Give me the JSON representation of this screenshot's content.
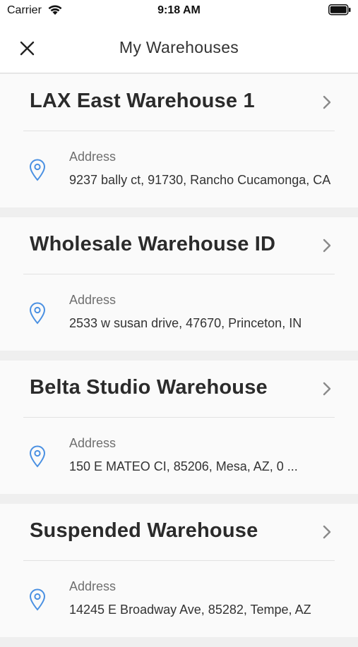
{
  "status_bar": {
    "carrier": "Carrier",
    "time": "9:18 AM",
    "wifi_icon": "wifi-icon",
    "battery_icon": "battery-icon"
  },
  "nav": {
    "title": "My Warehouses",
    "close_icon": "close-icon"
  },
  "colors": {
    "pin": "#4a90e2",
    "background": "#efefef",
    "card": "#fafafa"
  },
  "warehouses": [
    {
      "name": "LAX East Warehouse 1",
      "address_label": "Address",
      "address": "9237 bally ct, 91730, Rancho Cucamonga, CA"
    },
    {
      "name": "Wholesale Warehouse ID",
      "address_label": "Address",
      "address": "2533 w susan drive, 47670, Princeton, IN"
    },
    {
      "name": "Belta Studio Warehouse",
      "address_label": "Address",
      "address": "150 E MATEO CI, 85206, Mesa, AZ, 0 ..."
    },
    {
      "name": "Suspended Warehouse",
      "address_label": "Address",
      "address": "14245 E Broadway Ave, 85282, Tempe, AZ"
    }
  ]
}
